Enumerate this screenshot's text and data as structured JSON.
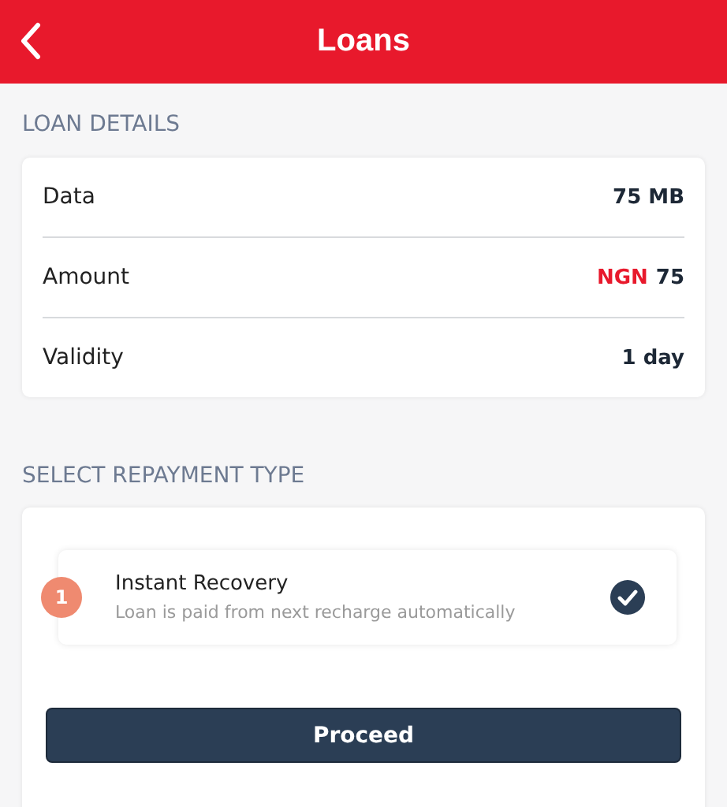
{
  "header": {
    "title": "Loans"
  },
  "loan_details": {
    "heading": "LOAN DETAILS",
    "rows": [
      {
        "label": "Data",
        "value": "75 MB"
      },
      {
        "label": "Amount",
        "currency": "NGN",
        "value": "75"
      },
      {
        "label": "Validity",
        "value": "1 day"
      }
    ]
  },
  "repayment": {
    "heading": "SELECT REPAYMENT TYPE",
    "options": [
      {
        "number": "1",
        "title": "Instant Recovery",
        "description": "Loan is paid from next recharge automatically",
        "selected": true
      }
    ]
  },
  "button": "Proceed"
}
